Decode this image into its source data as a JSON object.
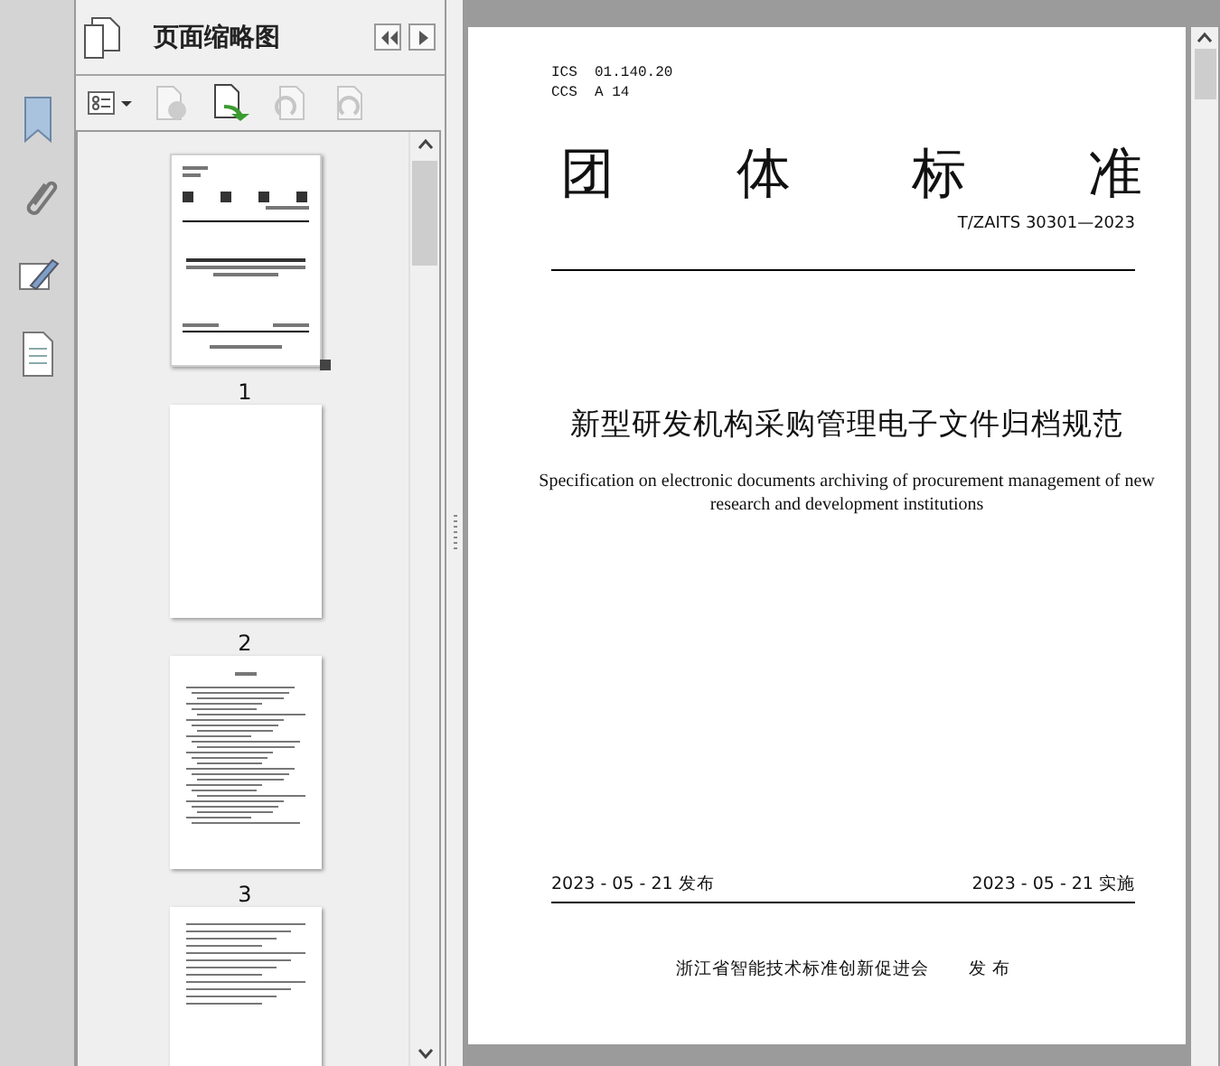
{
  "panel": {
    "title": "页面缩略图"
  },
  "thumbnails": [
    {
      "kind": "cover",
      "label": "1",
      "selected": true
    },
    {
      "kind": "blank",
      "label": "2",
      "selected": false
    },
    {
      "kind": "toc",
      "label": "3",
      "selected": false
    },
    {
      "kind": "list",
      "selected": false
    }
  ],
  "document": {
    "ics": "ICS  01.140.20",
    "ccs": "CCS  A 14",
    "heading": "团 体 标 准",
    "code": "T/ZAITS 30301—2023",
    "title": "新型研发机构采购管理电子文件归档规范",
    "subtitle": "Specification on electronic documents archiving of procurement management of new research and development institutions",
    "issue_date": "2023 - 05 - 21 发布",
    "effective_date": "2023 - 05 - 21 实施",
    "publisher": "浙江省智能技术标准创新促进会",
    "publish_word": "发 布"
  }
}
